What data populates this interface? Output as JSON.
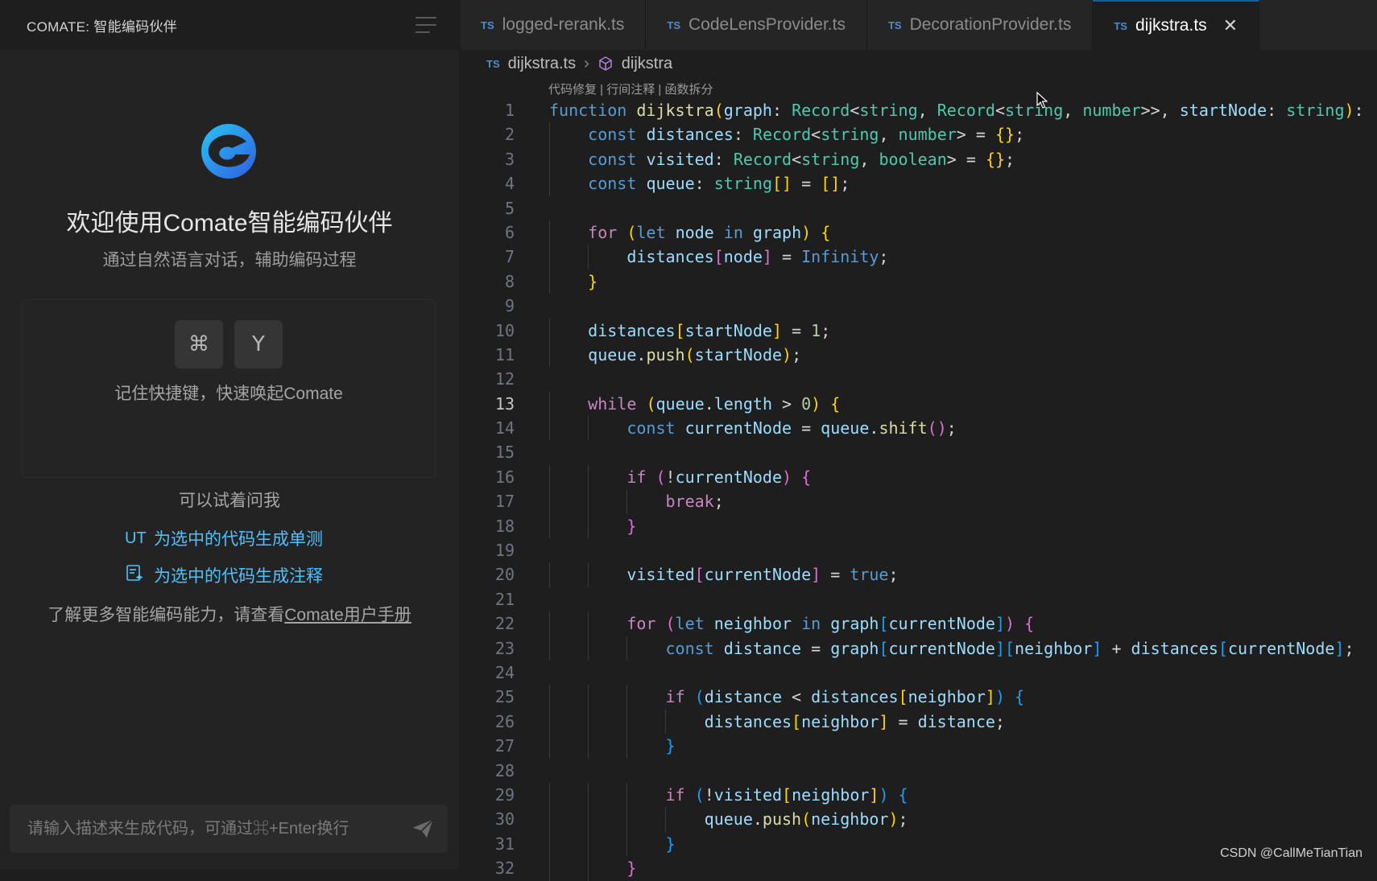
{
  "sidebar": {
    "title": "COMATE: 智能编码伙伴",
    "welcome": "欢迎使用Comate智能编码伙伴",
    "subtitle": "通过自然语言对话，辅助编码过程",
    "shortcut_keys": [
      "⌘",
      "Y"
    ],
    "shortcut_hint": "记住快捷键，快速唤起Comate",
    "try_ask": "可以试着问我",
    "suggestions": [
      {
        "icon": "UT",
        "label": "为选中的代码生成单测"
      },
      {
        "icon": "comment-icon",
        "label": "为选中的代码生成注释"
      }
    ],
    "learn_more_prefix": "了解更多智能编码能力，请查看",
    "learn_more_link": "Comate用户手册",
    "input_placeholder": "请输入描述来生成代码，可通过⌘+Enter换行"
  },
  "tabs": [
    {
      "badge": "TS",
      "label": "logged-rerank.ts",
      "active": false
    },
    {
      "badge": "TS",
      "label": "CodeLensProvider.ts",
      "active": false
    },
    {
      "badge": "TS",
      "label": "DecorationProvider.ts",
      "active": false
    },
    {
      "badge": "TS",
      "label": "dijkstra.ts",
      "active": true
    }
  ],
  "breadcrumb": {
    "badge": "TS",
    "file": "dijkstra.ts",
    "symbol": "dijkstra"
  },
  "codelens": [
    "代码修复",
    "行间注释",
    "函数拆分"
  ],
  "current_line": 13,
  "code_lines": [
    "function dijkstra(graph: Record<string, Record<string, number>>, startNode: string):",
    "    const distances: Record<string, number> = {};",
    "    const visited: Record<string, boolean> = {};",
    "    const queue: string[] = [];",
    "",
    "    for (let node in graph) {",
    "        distances[node] = Infinity;",
    "    }",
    "",
    "    distances[startNode] = 1;",
    "    queue.push(startNode);",
    "",
    "    while (queue.length > 0) {",
    "        const currentNode = queue.shift();",
    "",
    "        if (!currentNode) {",
    "            break;",
    "        }",
    "",
    "        visited[currentNode] = true;",
    "",
    "        for (let neighbor in graph[currentNode]) {",
    "            const distance = graph[currentNode][neighbor] + distances[currentNode];",
    "",
    "            if (distance < distances[neighbor]) {",
    "                distances[neighbor] = distance;",
    "            }",
    "",
    "            if (!visited[neighbor]) {",
    "                queue.push(neighbor);",
    "            }",
    "        }"
  ],
  "watermark": "CSDN @CallMeTianTian",
  "colors": {
    "accent": "#4fc1ff",
    "keyword": "#569cd6",
    "control": "#c586c0",
    "function": "#dcdcaa",
    "variable": "#9cdcfe",
    "type": "#4ec9b0"
  }
}
